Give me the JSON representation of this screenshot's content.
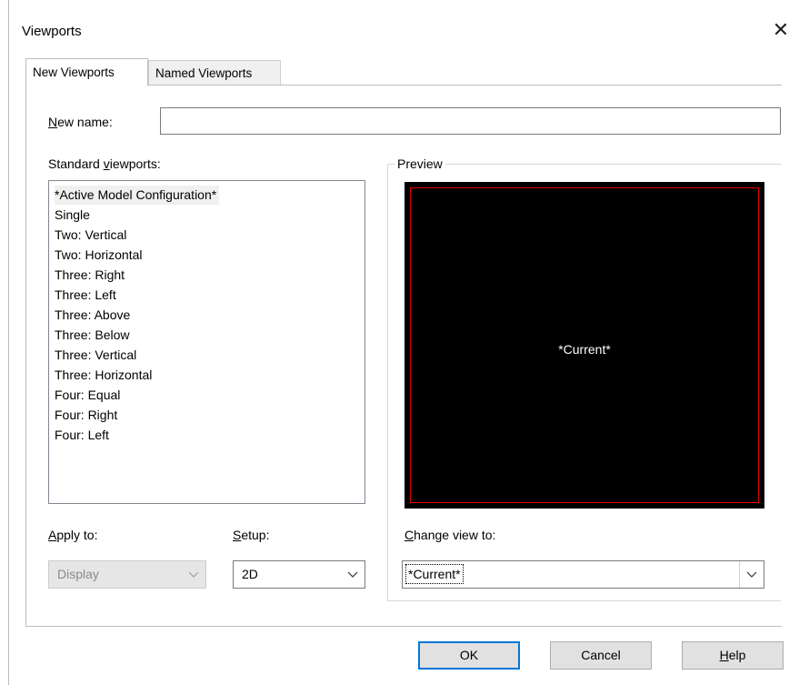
{
  "window": {
    "title": "Viewports",
    "close_glyph": "✕"
  },
  "tabs": [
    {
      "label": "New Viewports",
      "active": true
    },
    {
      "label": "Named Viewports",
      "active": false
    }
  ],
  "new_name": {
    "label_prefix": "N",
    "label_rest": "ew name:",
    "value": ""
  },
  "standard": {
    "label_prefix": "Standard ",
    "label_hotkey": "v",
    "label_rest": "iewports:",
    "items": [
      "*Active Model Configuration*",
      "Single",
      "Two:  Vertical",
      "Two:  Horizontal",
      "Three: Right",
      "Three: Left",
      "Three: Above",
      "Three: Below",
      "Three: Vertical",
      "Three: Horizontal",
      "Four:  Equal",
      "Four:  Right",
      "Four:  Left"
    ],
    "selected_index": 0
  },
  "preview": {
    "title": "Preview",
    "text": "*Current*"
  },
  "apply_to": {
    "label_hotkey": "A",
    "label_rest": "pply to:",
    "value": "Display",
    "enabled": false
  },
  "setup": {
    "label_hotkey": "S",
    "label_rest": "etup:",
    "value": "2D"
  },
  "change_view": {
    "label_hotkey": "C",
    "label_rest": "hange view to:",
    "value": "*Current*"
  },
  "buttons": {
    "ok": "OK",
    "cancel": "Cancel",
    "help_hotkey": "H",
    "help_rest": "elp"
  },
  "colors": {
    "preview_bg": "#000000",
    "preview_border": "#e00000",
    "default_button_border": "#0078d7"
  }
}
